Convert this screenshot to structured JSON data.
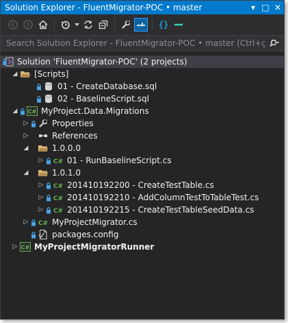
{
  "window": {
    "title": "Solution Explorer - FluentMigrator-POC • master",
    "buttons": [
      "▾",
      "□",
      "✕"
    ]
  },
  "search": {
    "placeholder": "Search Solution Explorer - FluentMigrator-POC • master (Ctrl+ç)"
  },
  "tree": {
    "solution": "Solution 'FluentMigrator-POC' (2 projects)",
    "scripts_folder": "[Scripts]",
    "script1": "01 - CreateDatabase.sql",
    "script2": "02 - BaselineScript.sql",
    "project1": "MyProject.Data.Migrations",
    "properties": "Properties",
    "references": "References",
    "folder_100": "1.0.0.0",
    "file_run_baseline": "01 - RunBaselineScript.cs",
    "folder_101": "1.0.1.0",
    "file_create_table": "201410192200 - CreateTestTable.cs",
    "file_add_column": "201410192210 - AddColumnTestToTableTest.cs",
    "file_seed": "201410192215 - CreateTestTableSeedData.cs",
    "project_migrator": "MyProjectMigrator.cs",
    "packages": "packages.config",
    "project2": "MyProjectMigratorRunner"
  },
  "colors": {
    "accent": "#007acc",
    "background": "#252526",
    "text": "#f1f1f1",
    "csharp": "#68b04f",
    "folder": "#dcb67a",
    "lock": "#4aa3e8"
  }
}
